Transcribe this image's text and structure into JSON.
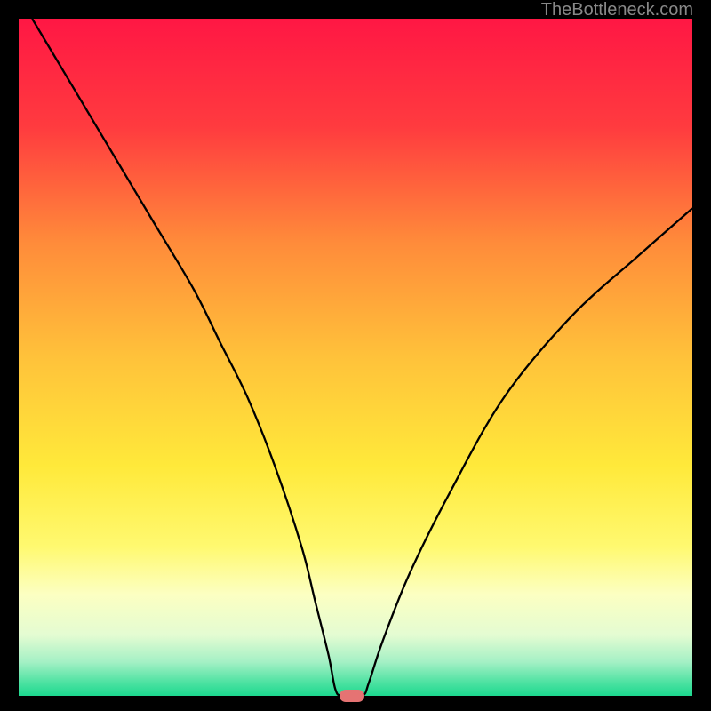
{
  "watermark": "TheBottleneck.com",
  "chart_data": {
    "type": "line",
    "title": "",
    "xlabel": "",
    "ylabel": "",
    "xlim": [
      0,
      100
    ],
    "ylim": [
      0,
      100
    ],
    "background_gradient": {
      "stops": [
        {
          "pos": 0,
          "color": "#ff1744"
        },
        {
          "pos": 16,
          "color": "#ff3b3f"
        },
        {
          "pos": 33,
          "color": "#ff8b3a"
        },
        {
          "pos": 50,
          "color": "#ffc23a"
        },
        {
          "pos": 66,
          "color": "#ffe93a"
        },
        {
          "pos": 78,
          "color": "#fff970"
        },
        {
          "pos": 85,
          "color": "#fcffc2"
        },
        {
          "pos": 91,
          "color": "#e4fcd2"
        },
        {
          "pos": 95,
          "color": "#a4f0c5"
        },
        {
          "pos": 98,
          "color": "#4ee2a2"
        },
        {
          "pos": 100,
          "color": "#1cd88f"
        }
      ]
    },
    "series": [
      {
        "name": "bottleneck-curve",
        "x": [
          2,
          8,
          14,
          20,
          26,
          30,
          34,
          38,
          42,
          44,
          46,
          47,
          48,
          51,
          52,
          54,
          58,
          64,
          72,
          82,
          92,
          100
        ],
        "y": [
          100,
          90,
          80,
          70,
          60,
          52,
          44,
          34,
          22,
          14,
          6,
          1,
          0,
          0,
          2,
          8,
          18,
          30,
          44,
          56,
          65,
          72
        ]
      }
    ],
    "marker": {
      "x": 49.5,
      "y": 0,
      "color": "#e57373"
    }
  }
}
